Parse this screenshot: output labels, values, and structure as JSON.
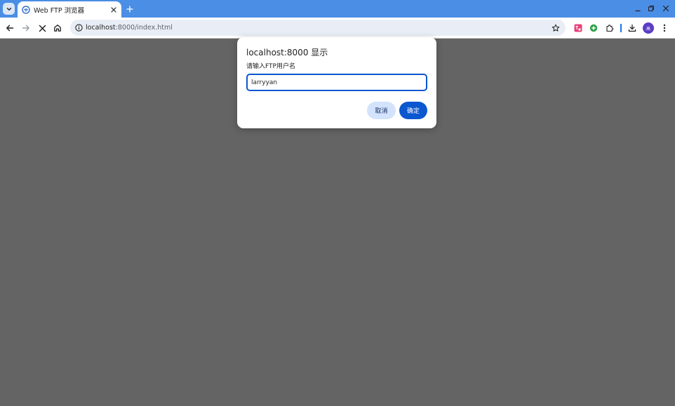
{
  "tab": {
    "title": "Web FTP 浏览器"
  },
  "address_bar": {
    "host": "localhost",
    "path": ":8000/index.html"
  },
  "dialog": {
    "title": "localhost:8000 显示",
    "message": "请输入FTP用户名",
    "input_value": "larryyan",
    "cancel_label": "取消",
    "ok_label": "确定"
  },
  "profile": {
    "initials": "高"
  },
  "colors": {
    "tabstrip": "#4a8ee5",
    "page_overlay": "#646464",
    "primary_button": "#0b57d0",
    "secondary_button": "#d3e3fd",
    "focus_border": "#0b57d0"
  },
  "icons": {
    "tab_search": "chevron-down-icon",
    "favicon": "wifi-ftp-icon",
    "tab_close": "close-icon",
    "new_tab": "plus-icon",
    "back": "arrow-left-icon",
    "forward": "arrow-right-icon",
    "stop": "close-icon",
    "home": "home-icon",
    "site_info": "info-icon",
    "bookmark": "star-icon",
    "extensions": "puzzle-icon",
    "download": "download-icon",
    "menu": "kebab-icon"
  }
}
